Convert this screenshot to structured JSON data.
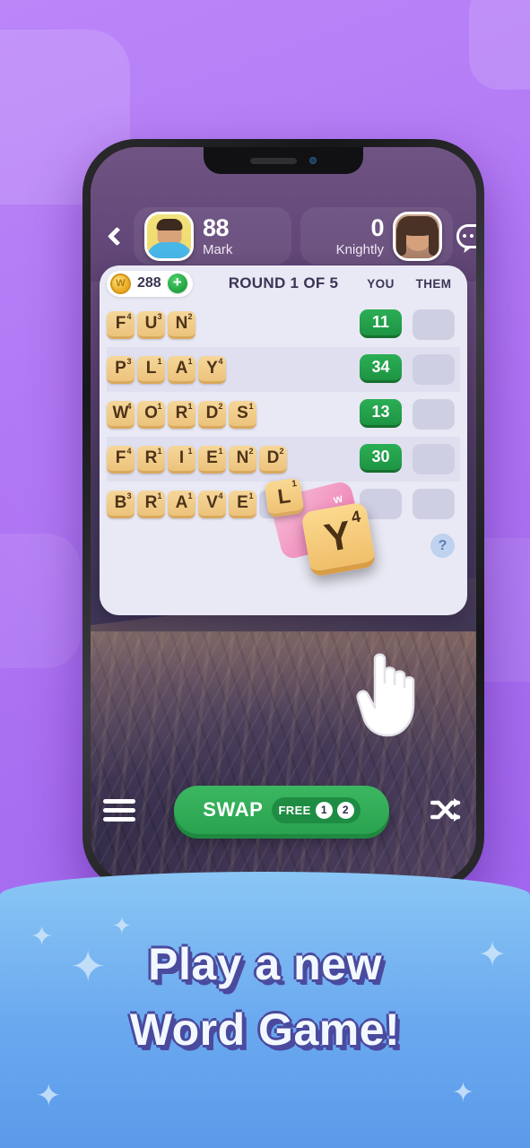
{
  "background": {
    "accent": "#b57cf6"
  },
  "header": {
    "back_icon": "chevron-left-icon",
    "chat_icon": "chat-bubble-icon",
    "players": [
      {
        "name": "Mark",
        "score": "88",
        "avatar": "male-avatar"
      },
      {
        "name": "Knightly",
        "score": "0",
        "avatar": "female-avatar"
      }
    ]
  },
  "panel": {
    "coin_symbol": "W",
    "coin_count": "288",
    "plus_label": "+",
    "round_label": "ROUND 1 OF 5",
    "columns": [
      "YOU",
      "THEM"
    ],
    "hint_label": "?",
    "rows": [
      {
        "word": "FUN",
        "letters": [
          {
            "c": "F",
            "v": "4"
          },
          {
            "c": "U",
            "v": "3"
          },
          {
            "c": "N",
            "v": "2"
          }
        ],
        "you": "11",
        "them": ""
      },
      {
        "word": "PLAY",
        "letters": [
          {
            "c": "P",
            "v": "3"
          },
          {
            "c": "L",
            "v": "1"
          },
          {
            "c": "A",
            "v": "1"
          },
          {
            "c": "Y",
            "v": "4"
          }
        ],
        "you": "34",
        "them": ""
      },
      {
        "word": "WORDS",
        "letters": [
          {
            "c": "W",
            "v": "4"
          },
          {
            "c": "O",
            "v": "1"
          },
          {
            "c": "R",
            "v": "1"
          },
          {
            "c": "D",
            "v": "2"
          },
          {
            "c": "S",
            "v": "1"
          }
        ],
        "you": "13",
        "them": ""
      },
      {
        "word": "FRIEND",
        "letters": [
          {
            "c": "F",
            "v": "4"
          },
          {
            "c": "R",
            "v": "1"
          },
          {
            "c": "I",
            "v": "1"
          },
          {
            "c": "E",
            "v": "1"
          },
          {
            "c": "N",
            "v": "2"
          },
          {
            "c": "D",
            "v": "2"
          }
        ],
        "you": "30",
        "them": ""
      },
      {
        "word": "BRAVE",
        "letters": [
          {
            "c": "B",
            "v": "3"
          },
          {
            "c": "R",
            "v": "1"
          },
          {
            "c": "A",
            "v": "1"
          },
          {
            "c": "V",
            "v": "4"
          },
          {
            "c": "E",
            "v": "1"
          }
        ],
        "you": "",
        "them": ""
      }
    ],
    "dragging": {
      "tile_l": {
        "c": "L",
        "v": "1"
      },
      "tile_y": {
        "c": "Y",
        "v": "4"
      },
      "blob_label": "w"
    }
  },
  "bottom": {
    "menu_icon": "hamburger-menu-icon",
    "swap_label": "SWAP",
    "free_label": "FREE",
    "free_counts": [
      "1",
      "2"
    ],
    "shuffle_icon": "shuffle-icon"
  },
  "banner": {
    "line1": "Play a new",
    "line2": "Word Game!",
    "sparkle_icon": "sparkle-icon"
  }
}
